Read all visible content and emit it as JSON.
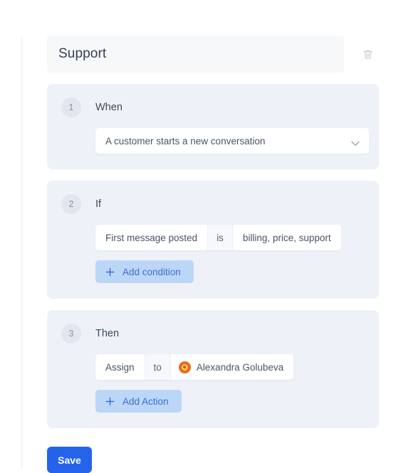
{
  "automation": {
    "title": "Support",
    "title_placeholder": "Name your automation",
    "delete_icon": "trash-icon"
  },
  "steps": [
    {
      "number": "1",
      "label": "When",
      "trigger": {
        "value": "A customer starts a new conversation",
        "chevron_icon": "chevron-down-icon"
      }
    },
    {
      "number": "2",
      "label": "If",
      "condition": {
        "field": "First message posted",
        "operator": "is",
        "value": "billing, price, support"
      },
      "add_button": {
        "label": "Add condition",
        "icon": "plus-icon"
      }
    },
    {
      "number": "3",
      "label": "Then",
      "action": {
        "verb": "Assign",
        "preposition": "to",
        "assignee": "Alexandra Golubeva",
        "assignee_avatar_icon": "user-avatar-icon"
      },
      "add_button": {
        "label": "Add Action",
        "icon": "plus-icon"
      }
    }
  ],
  "footer": {
    "save_label": "Save"
  },
  "colors": {
    "accent_blue": "#2563eb",
    "add_button_bg": "#bcd6f7",
    "add_button_text": "#3b6fd4",
    "card_bg": "#eef1f7",
    "avatar_orange": "#f26522"
  }
}
